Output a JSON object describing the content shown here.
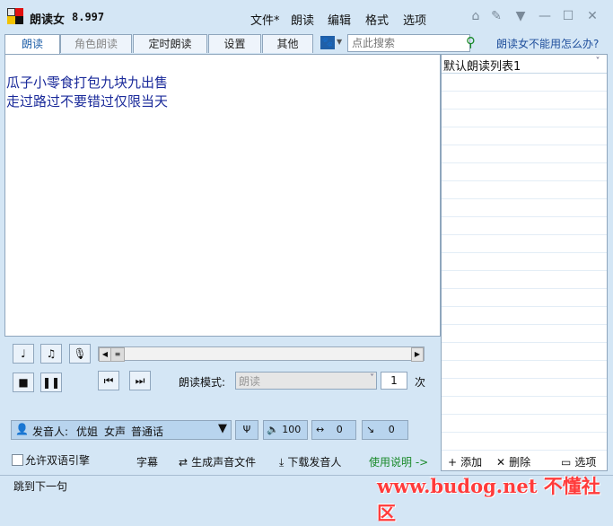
{
  "app": {
    "title": "朗读女",
    "version": "8.997"
  },
  "menu": [
    "文件*",
    "朗读",
    "编辑",
    "格式",
    "选项"
  ],
  "tabs": [
    "朗读",
    "角色朗读",
    "定时朗读",
    "设置",
    "其他"
  ],
  "search": {
    "placeholder": "点此搜索"
  },
  "help_link": "朗读女不能用怎么办?",
  "text_lines": [
    "瓜子小零食打包九块九出售",
    "走过路过不要错过仅限当天"
  ],
  "playlist": {
    "title": "默认朗读列表1"
  },
  "controls": {
    "mode_label": "朗读模式:",
    "mode_value": "朗读",
    "repeat": "1",
    "repeat_unit": "次"
  },
  "speaker": {
    "label": "发音人:",
    "name": "优姐",
    "gender": "女声",
    "language": "普通话"
  },
  "params": {
    "volume": "100",
    "speed": "0",
    "pitch": "0"
  },
  "footer": {
    "dual_engine": "允许双语引擎",
    "subtitles": "字幕",
    "generate_audio": "生成声音文件",
    "download_voice": "下载发音人",
    "instructions": "使用说明 ->"
  },
  "playlist_footer": {
    "add": "添加",
    "delete": "删除",
    "options": "选项"
  },
  "status": "跳到下一句",
  "watermark": "www.budog.net 不懂社区",
  "colors": {
    "accent": "#1f5fa8",
    "text_blue": "#1a2a9a",
    "green": "#1a8a2a",
    "watermark": "#ff3b3b"
  }
}
